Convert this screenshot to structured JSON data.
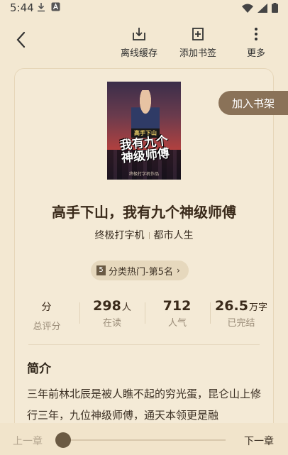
{
  "status": {
    "time": "5:44"
  },
  "toolbar": {
    "offline_label": "离线缓存",
    "bookmark_label": "添加书签",
    "more_label": "更多"
  },
  "book": {
    "cover_top": "高手下山",
    "cover_title_line1": "我有九个",
    "cover_title_line2": "神级师傅",
    "cover_author": "终极打字机作品",
    "add_to_shelf": "加入书架",
    "title": "高手下山，我有九个神级师傅",
    "author": "终极打字机",
    "category": "都市人生",
    "rank_num": "5",
    "rank_text": "分类热门-第5名"
  },
  "stats": [
    {
      "value": "分",
      "unit": "",
      "label": "总评分"
    },
    {
      "value": "298",
      "unit": "人",
      "label": "在读"
    },
    {
      "value": "712",
      "unit": "",
      "label": "人气"
    },
    {
      "value": "26.5",
      "unit": "万字",
      "label": "已完结"
    }
  ],
  "intro": {
    "heading": "简介",
    "text": "三年前林北辰是被人瞧不起的穷光蛋，昆仑山上修行三年，九位神级师傅，通天本领更是融"
  },
  "reader": {
    "prev": "上一章",
    "next": "下一章",
    "progress": 0
  },
  "colors": {
    "background": "#f3e8d2",
    "accent": "#8a7258"
  }
}
